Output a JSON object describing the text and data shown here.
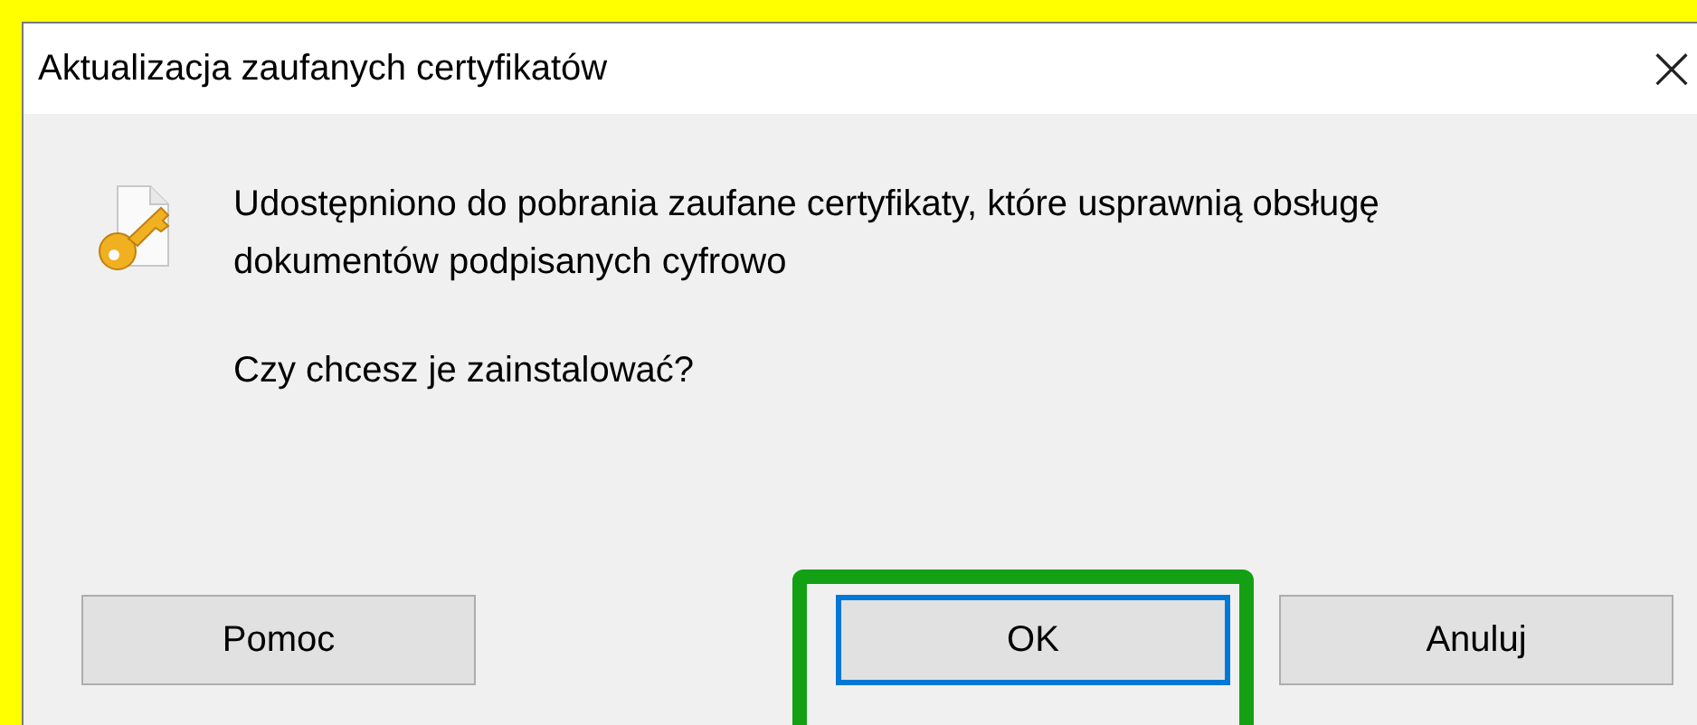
{
  "window": {
    "title": "Aktualizacja zaufanych certyfikatów",
    "close": "×"
  },
  "message": {
    "lines": [
      "Udostępniono do pobrania zaufane certyfikaty, które usprawnią obsługę",
      "dokumentów podpisanych cyfrowo"
    ],
    "question": "Czy chcesz je zainstalować?"
  },
  "buttons": [
    {
      "label": "Pomoc",
      "default": false,
      "highlighted": false
    },
    {
      "label": "OK",
      "default": true,
      "highlighted": true
    },
    {
      "label": "Anuluj",
      "default": false,
      "highlighted": false
    }
  ]
}
